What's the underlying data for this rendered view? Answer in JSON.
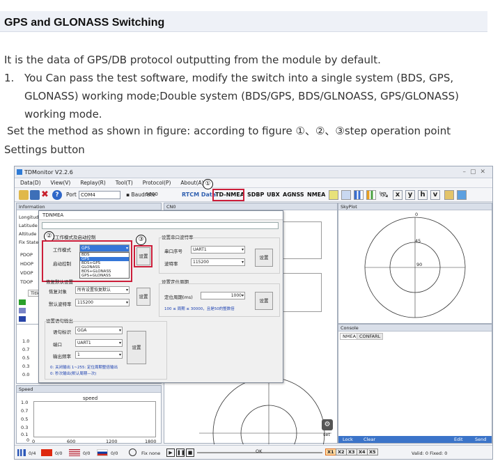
{
  "doc": {
    "heading": "GPS and GLONASS Switching",
    "intro": "It is the data of GPS/DB protocol outputting from the module by default.",
    "item_number": "1.",
    "item_text": "You Can pass the test software, modify the switch into a single system (BDS, GPS, GLONASS) working mode;Double system (BDS/GPS, BDS/GLNOASS, GPS/GLONASS) working mode.",
    "method_line": "Set the method as shown in figure: according to figure ①、②、③step operation point",
    "settings_line": "Settings button"
  },
  "app": {
    "title": "TDMonitor V2.2.6",
    "menu": [
      "Data(D)",
      "View(V)",
      "Replay(R)",
      "Tool(T)",
      "Protocol(P)",
      "About(A)"
    ],
    "toolbar": {
      "port_label": "Port",
      "port_value": "COM4",
      "baud_label": "Baudrate",
      "baud_value": "9600",
      "rtcm": "RTCM Data",
      "td_nmea": "TD-NMEA",
      "sdbp": "SDBP",
      "ubx": "UBX",
      "agnss": "AGNSS",
      "nmea": "NMEA",
      "letters": [
        "x",
        "y",
        "h",
        "v"
      ]
    },
    "steps": [
      "①",
      "②",
      "③"
    ],
    "panels": {
      "information": "Information",
      "cn0": "CN0",
      "skyplot": "SkyPlot",
      "console": "Console",
      "speed": "Speed",
      "speed_chart_title": "speed"
    },
    "info_rows": [
      "Longitude",
      "Latitude",
      "Altitude",
      "Fix State"
    ],
    "dop_rows": [
      "PDOP",
      "HDOP",
      "VDOP",
      "TDOP"
    ],
    "title_col": "Title",
    "left_chart_ticks": [
      "1.0",
      "0.7",
      "0.5",
      "0.3",
      "0.0"
    ],
    "speed_ticks_y": [
      "1.0",
      "0.7",
      "0.5",
      "0.3",
      "0.1",
      "0"
    ],
    "speed_ticks_x": [
      "0",
      "600",
      "1200",
      "1800"
    ],
    "skyplot_labels": [
      "0",
      "45",
      "90"
    ],
    "console_tabs": [
      "NMEA",
      "CONFARL"
    ],
    "console_buttons": [
      "Lock",
      "Clear",
      "Edit",
      "Send"
    ],
    "set_label": "set",
    "status": {
      "flag_labels": [
        "0/4",
        "0/0",
        "0/0",
        "0/0"
      ],
      "fix": "Fix none",
      "ok": "OK",
      "speeds": [
        "X1",
        "X2",
        "X3",
        "X4",
        "X5"
      ],
      "valid": "Valid: 0 Fixed: 0"
    }
  },
  "dialog": {
    "title": "TDNMEA",
    "section_mode": "设置工作模式及启动控制",
    "mode_label": "工作模式",
    "mode_selected": "GPS",
    "mode_options": [
      "BDS",
      "GPS",
      "BDS+GPS",
      "GLONASS",
      "BDS+GLONASS",
      "GPS+GLONASS"
    ],
    "start_label": "启动控制",
    "set_button": "设置",
    "restore_section": "恢复默认设置",
    "restore_label": "恢复对象",
    "restore_value": "所有设置恢复默认",
    "default_baud_label": "默认波特率",
    "default_baud_value": "115200",
    "serial_section": "设置串口波特率",
    "serial_no_label": "串口序号",
    "serial_no_value": "UART1",
    "baud_label": "波特率",
    "baud_value": "115200",
    "period_section": "设置定位周期",
    "period_label": "定位周期(ms)",
    "period_value": "1000",
    "period_hint": "100 ≤ 周期 ≤ 30000，且是50的整数倍",
    "output_section": "设置语句输出",
    "sentence_label": "语句标识",
    "sentence_value": "GGA",
    "port_label": "端口",
    "port_value": "UART1",
    "freq_label": "输出频率",
    "freq_value": "1",
    "freq_hint1": "0: 关闭输出  1~255: 定位周期整倍输出",
    "freq_hint2": "0: 秒次输出(默认周期—次)"
  }
}
